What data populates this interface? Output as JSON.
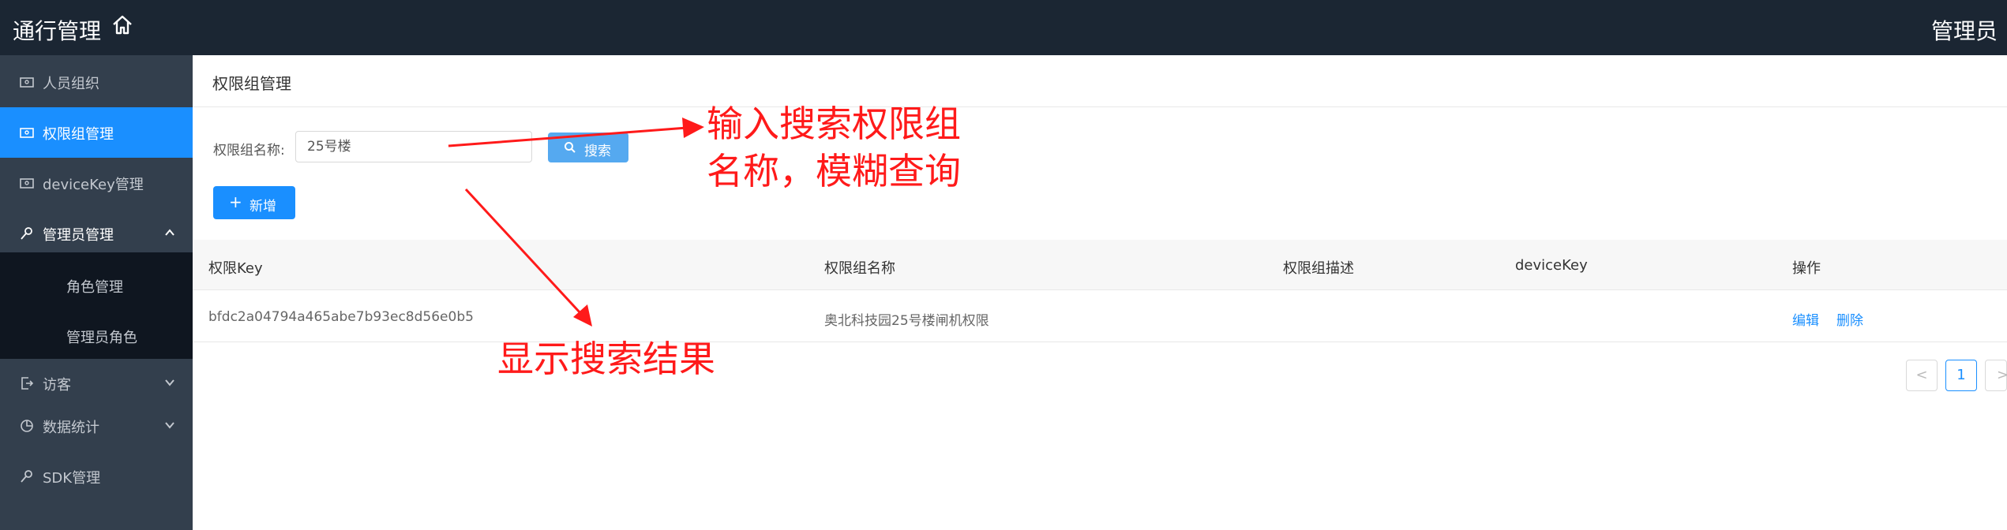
{
  "header": {
    "app_title": "通行管理",
    "user_name": "管理员",
    "home_icon": "home-icon"
  },
  "sidebar": {
    "items": [
      {
        "label": "人员组织",
        "icon": "id-card-icon"
      },
      {
        "label": "权限组管理",
        "icon": "id-card-icon",
        "active": true
      },
      {
        "label": "deviceKey管理",
        "icon": "id-card-icon"
      },
      {
        "label": "管理员管理",
        "icon": "key-icon",
        "expanded": true
      },
      {
        "label": "访客",
        "icon": "visitor-icon"
      },
      {
        "label": "数据统计",
        "icon": "pie-chart-icon"
      },
      {
        "label": "SDK管理",
        "icon": "key-icon"
      }
    ],
    "submenu": [
      {
        "label": "角色管理"
      },
      {
        "label": "管理员角色"
      }
    ]
  },
  "page": {
    "title": "权限组管理"
  },
  "search": {
    "label": "权限组名称:",
    "value": "25号楼",
    "button_label": "搜索"
  },
  "add_button_label": "新增",
  "table": {
    "columns": [
      "权限Key",
      "权限组名称",
      "权限组描述",
      "deviceKey",
      "操作"
    ],
    "rows": [
      {
        "key": "bfdc2a04794a465abe7b93ec8d56e0b5",
        "name": "奥北科技园25号楼闸机权限",
        "description": "",
        "device_key": "",
        "actions": [
          "编辑",
          "删除"
        ]
      }
    ]
  },
  "pagination": {
    "prev": "<",
    "current": "1",
    "next": ">"
  },
  "annotations": {
    "search_note_line1": "输入搜索权限组",
    "search_note_line2": "名称，模糊查询",
    "result_note": "显示搜索结果",
    "color": "#ff1a1a"
  },
  "colors": {
    "accent": "#1a8fff",
    "topbar": "#1b2633",
    "sidebar": "#333f4d"
  }
}
